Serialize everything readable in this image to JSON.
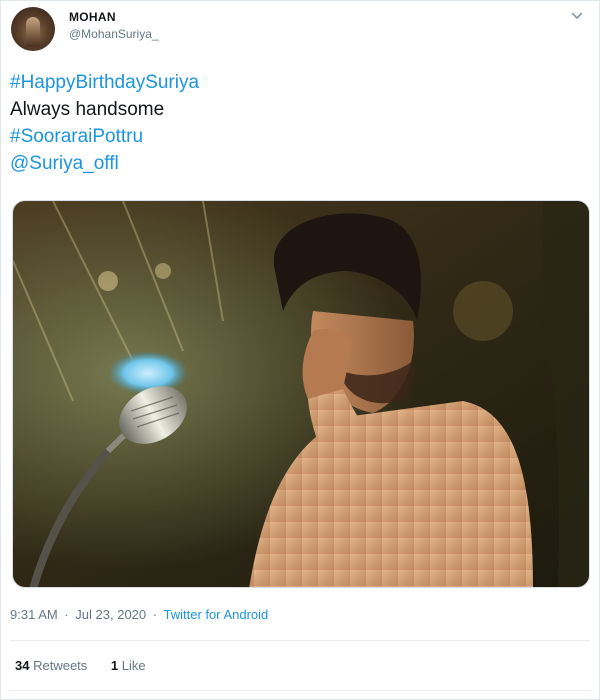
{
  "author": {
    "display_name": "MOHAN",
    "handle": "@MohanSuriya_"
  },
  "tweet": {
    "lines": [
      {
        "text": "#HappyBirthdaySuriya",
        "is_link": true
      },
      {
        "text": "Always handsome",
        "is_link": false
      },
      {
        "text": "#SooraraiPottru",
        "is_link": true
      },
      {
        "text": "@Suriya_offl",
        "is_link": true
      }
    ]
  },
  "meta": {
    "time": "9:31 AM",
    "separator": "·",
    "date": "Jul 23, 2020",
    "source": "Twitter for Android"
  },
  "stats": {
    "retweets_count": "34",
    "retweets_label": "Retweets",
    "likes_count": "1",
    "likes_label": "Like"
  },
  "icons": {
    "menu": "chevron-down-icon"
  },
  "colors": {
    "link": "#1b95e0",
    "secondary_text": "#657786",
    "primary_text": "#14171a"
  }
}
